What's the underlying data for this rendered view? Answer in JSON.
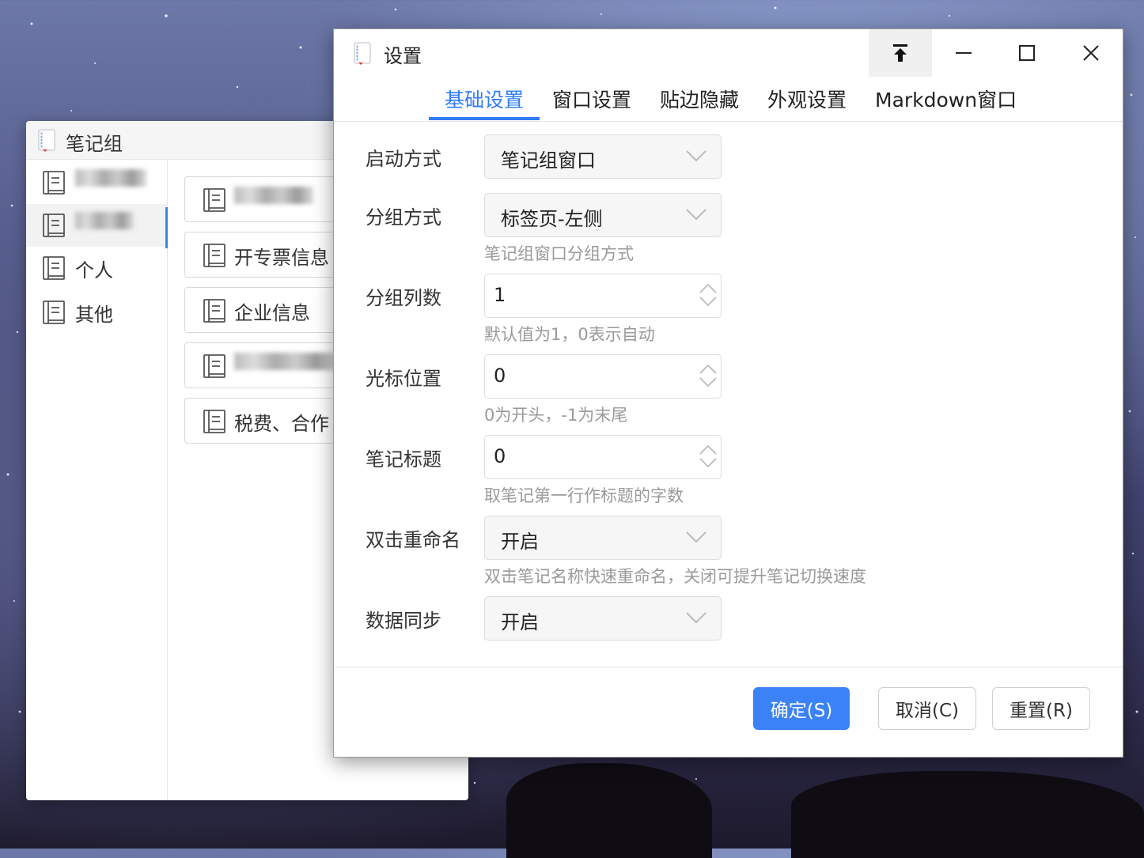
{
  "notebook_window": {
    "title": "笔记组",
    "sidebar_items": [
      {
        "label": "",
        "blurred": true,
        "selected": false
      },
      {
        "label": "",
        "blurred": true,
        "selected": true
      },
      {
        "label": "个人",
        "blurred": false,
        "selected": false
      },
      {
        "label": "其他",
        "blurred": false,
        "selected": false
      }
    ],
    "cards": [
      {
        "label": "",
        "blurred": true
      },
      {
        "label": "开专票信息",
        "blurred": false
      },
      {
        "label": "企业信息",
        "blurred": false
      },
      {
        "label": "",
        "blurred": true
      },
      {
        "label": "税费、合作",
        "blurred": false
      }
    ]
  },
  "settings_dialog": {
    "title": "设置",
    "tabs": [
      "基础设置",
      "窗口设置",
      "贴边隐藏",
      "外观设置",
      "Markdown窗口"
    ],
    "active_tab": 0,
    "rows": {
      "startup": {
        "label": "启动方式",
        "value": "笔记组窗口"
      },
      "grouping": {
        "label": "分组方式",
        "value": "标签页-左侧",
        "hint": "笔记组窗口分组方式"
      },
      "columns": {
        "label": "分组列数",
        "value": "1",
        "hint": "默认值为1，0表示自动"
      },
      "cursor": {
        "label": "光标位置",
        "value": "0",
        "hint": "0为开头，-1为末尾"
      },
      "note_title": {
        "label": "笔记标题",
        "value": "0",
        "hint": "取笔记第一行作标题的字数"
      },
      "dblclick": {
        "label": "双击重命名",
        "value": "开启",
        "hint": "双击笔记名称快速重命名，关闭可提升笔记切换速度"
      },
      "sync": {
        "label": "数据同步",
        "value": "开启"
      }
    },
    "buttons": {
      "confirm": "确定(S)",
      "cancel": "取消(C)",
      "reset": "重置(R)"
    }
  },
  "colors": {
    "accent": "#2f7cf6",
    "primary_button": "#3b82f6"
  }
}
